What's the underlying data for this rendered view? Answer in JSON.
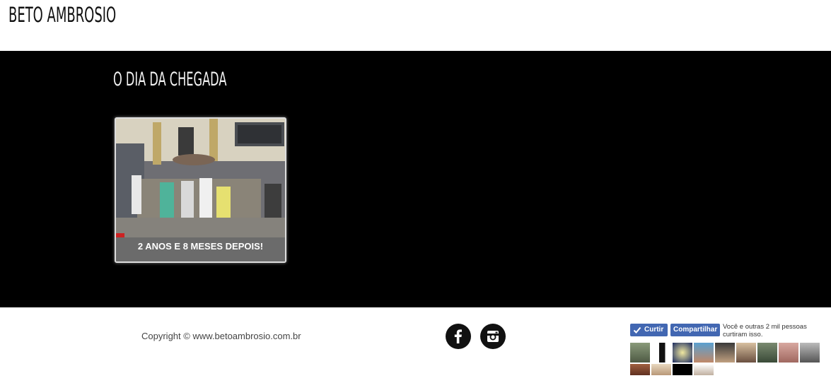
{
  "header": {
    "site_title": "BETO AMBROSIO"
  },
  "main": {
    "page_title": "O DIA DA CHEGADA",
    "card": {
      "caption": "2 ANOS E 8 MESES DEPOIS!"
    }
  },
  "footer": {
    "copyright": "Copyright © www.betoambrosio.com.br",
    "social": [
      {
        "name": "facebook",
        "icon": "facebook-icon"
      },
      {
        "name": "instagram",
        "icon": "instagram-icon"
      }
    ],
    "fb_widget": {
      "like_label": "Curtir",
      "share_label": "Compartilhar",
      "text": "Você e outras 2 mil pessoas curtiram isso.",
      "faces_count": 14
    }
  },
  "colors": {
    "main_bg": "#000000",
    "fb_blue": "#4267b2",
    "caption_bg": "#6b6b6b"
  }
}
